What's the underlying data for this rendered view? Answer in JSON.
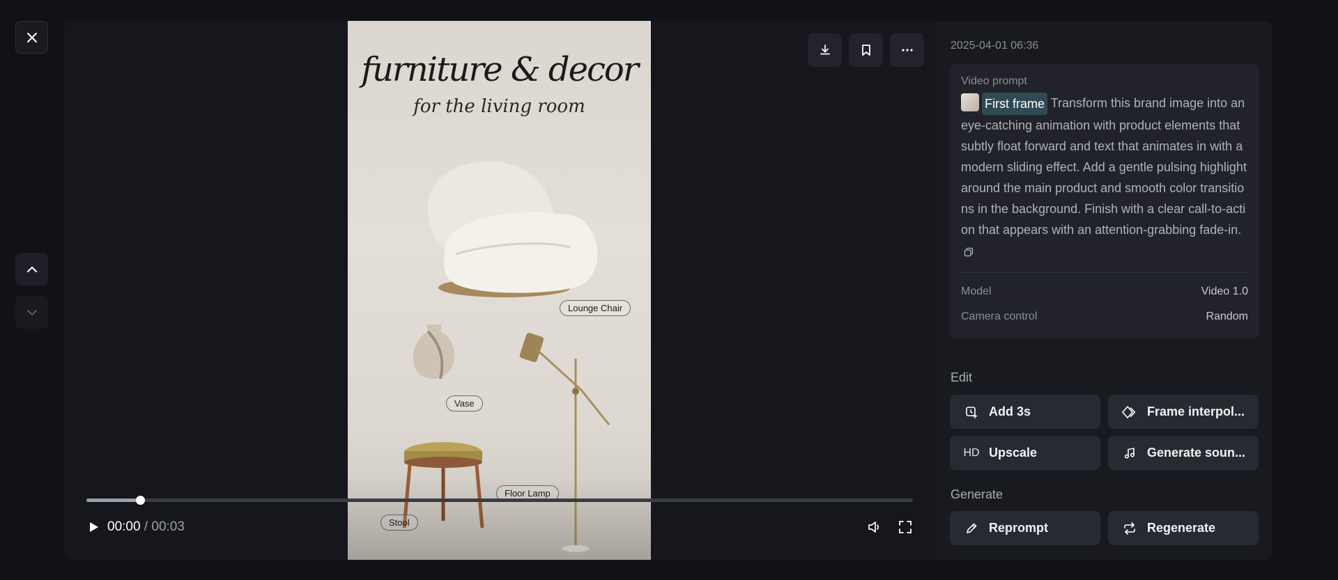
{
  "video": {
    "title": "furniture & decor",
    "subtitle": "for the living room",
    "labels": {
      "chair": "Lounge Chair",
      "vase": "Vase",
      "lamp": "Floor Lamp",
      "stool": "Stool"
    },
    "progress_fraction": 0.065
  },
  "player": {
    "current_time": "00:00",
    "separator": "/",
    "duration": "00:03"
  },
  "panel": {
    "date": "2025-04-01 06:36",
    "prompt_label": "Video prompt",
    "chip_label": "First frame",
    "prompt_text": "Transform this brand image into an eye-catching animation with product elements that subtly float forward and text that animates in with a modern sliding effect. Add a gentle pulsing highlight around the main product and smooth color transitions in the background. Finish with a clear call-to-action that appears with an attention-grabbing fade-in.",
    "meta": [
      {
        "key": "Model",
        "value": "Video 1.0"
      },
      {
        "key": "Camera control",
        "value": "Random"
      }
    ],
    "edit_title": "Edit",
    "edit_buttons": {
      "add": "Add 3s",
      "interp": "Frame interpol...",
      "upscale_badge": "HD",
      "upscale": "Upscale",
      "sound": "Generate soun..."
    },
    "generate_title": "Generate",
    "generate_buttons": {
      "reprompt": "Reprompt",
      "regenerate": "Regenerate"
    }
  },
  "icons": {
    "close": "close-icon",
    "up": "chevron-up-icon",
    "down": "chevron-down-icon",
    "download": "download-icon",
    "bookmark": "bookmark-icon",
    "more": "more-icon",
    "play": "play-icon",
    "volume": "volume-icon",
    "fullscreen": "fullscreen-icon"
  },
  "colors": {
    "background": "#111217",
    "panel": "#191a20",
    "chip_highlight": "#2e4a52"
  }
}
